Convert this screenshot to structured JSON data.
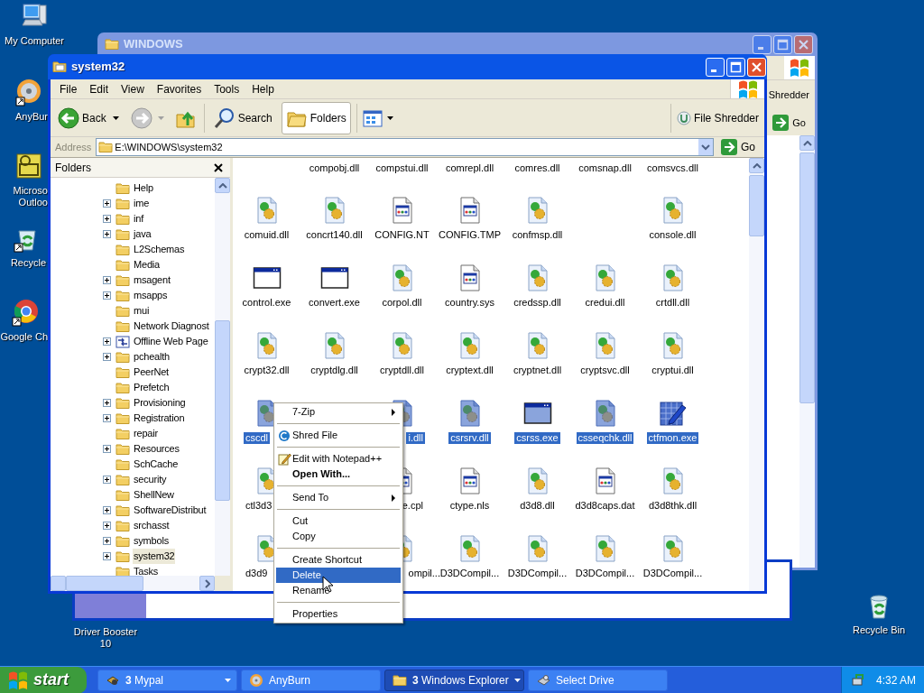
{
  "desktop_icons": [
    {
      "kind": "computer",
      "lines": [
        "My Computer"
      ]
    },
    {
      "kind": "disc",
      "lines": [
        "AnyBur"
      ]
    },
    {
      "kind": "mail",
      "lines": [
        "Microso",
        "Outloo"
      ]
    },
    {
      "kind": "recycle",
      "lines": [
        "Recycle"
      ]
    },
    {
      "kind": "browser",
      "lines": [
        "Google Ch"
      ]
    },
    {
      "lines": [
        "Driver Booster",
        "10"
      ]
    },
    {
      "kind": "bin",
      "lines": [
        "Recycle Bin"
      ]
    }
  ],
  "back_window": {
    "title": "WINDOWS",
    "toolbar_text": "Shredder",
    "go": "Go"
  },
  "window": {
    "title": "system32",
    "menu": [
      "File",
      "Edit",
      "View",
      "Favorites",
      "Tools",
      "Help"
    ],
    "toolbar": {
      "back": "Back",
      "search": "Search",
      "folders": {
        "label": "Folders",
        "selected": true
      },
      "shredder": "File Shredder"
    },
    "address": {
      "label": "Address",
      "value": "E:\\WINDOWS\\system32",
      "go": "Go"
    },
    "folders_pane": {
      "title": "Folders",
      "items": [
        {
          "label": "Help",
          "expandable": false,
          "selected": false
        },
        {
          "label": "ime",
          "expandable": true,
          "selected": false
        },
        {
          "label": "inf",
          "expandable": true,
          "selected": false
        },
        {
          "label": "java",
          "expandable": true,
          "selected": false
        },
        {
          "label": "L2Schemas",
          "expandable": false,
          "selected": false
        },
        {
          "label": "Media",
          "expandable": false,
          "selected": false
        },
        {
          "label": "msagent",
          "expandable": true,
          "selected": false
        },
        {
          "label": "msapps",
          "expandable": true,
          "selected": false
        },
        {
          "label": "mui",
          "expandable": false,
          "selected": false
        },
        {
          "label": "Network Diagnost",
          "expandable": false,
          "selected": false
        },
        {
          "label": "Offline Web Page",
          "expandable": true,
          "selected": false,
          "kind": "web"
        },
        {
          "label": "pchealth",
          "expandable": true,
          "selected": false
        },
        {
          "label": "PeerNet",
          "expandable": false,
          "selected": false
        },
        {
          "label": "Prefetch",
          "expandable": false,
          "selected": false
        },
        {
          "label": "Provisioning",
          "expandable": true,
          "selected": false
        },
        {
          "label": "Registration",
          "expandable": true,
          "selected": false
        },
        {
          "label": "repair",
          "expandable": false,
          "selected": false
        },
        {
          "label": "Resources",
          "expandable": true,
          "selected": false
        },
        {
          "label": "SchCache",
          "expandable": false,
          "selected": false
        },
        {
          "label": "security",
          "expandable": true,
          "selected": false
        },
        {
          "label": "ShellNew",
          "expandable": false,
          "selected": false
        },
        {
          "label": "SoftwareDistribut",
          "expandable": true,
          "selected": false
        },
        {
          "label": "srchasst",
          "expandable": true,
          "selected": false
        },
        {
          "label": "symbols",
          "expandable": true,
          "selected": false
        },
        {
          "label": "system32",
          "expandable": true,
          "selected": true
        },
        {
          "label": "Tasks",
          "expandable": false,
          "selected": false
        }
      ]
    },
    "file_grid": {
      "top_labels": [
        "compobj.dll",
        "compstui.dll",
        "comrepl.dll",
        "comres.dll",
        "comsnap.dll",
        "comsvcs.dll"
      ],
      "rows": [
        [
          {
            "name": "comuid.dll",
            "kind": "dll",
            "selected": false
          },
          {
            "name": "concrt140.dll",
            "kind": "dll",
            "selected": false
          },
          {
            "name": "CONFIG.NT",
            "kind": "doc",
            "selected": false
          },
          {
            "name": "CONFIG.TMP",
            "kind": "doc",
            "selected": false
          },
          {
            "name": "confmsp.dll",
            "kind": "dll",
            "selected": false
          },
          null,
          {
            "name": "console.dll",
            "kind": "dll",
            "selected": false
          }
        ],
        [
          {
            "name": "control.exe",
            "kind": "exe",
            "selected": false
          },
          {
            "name": "convert.exe",
            "kind": "exe",
            "selected": false
          },
          {
            "name": "corpol.dll",
            "kind": "dll",
            "selected": false
          },
          {
            "name": "country.sys",
            "kind": "doc",
            "selected": false
          },
          {
            "name": "credssp.dll",
            "kind": "dll",
            "selected": false
          },
          {
            "name": "credui.dll",
            "kind": "dll",
            "selected": false
          },
          {
            "name": "crtdll.dll",
            "kind": "dll",
            "selected": false
          }
        ],
        [
          {
            "name": "crypt32.dll",
            "kind": "dll",
            "selected": false
          },
          {
            "name": "cryptdlg.dll",
            "kind": "dll",
            "selected": false
          },
          {
            "name": "cryptdll.dll",
            "kind": "dll",
            "selected": false
          },
          {
            "name": "cryptext.dll",
            "kind": "dll",
            "selected": false
          },
          {
            "name": "cryptnet.dll",
            "kind": "dll",
            "selected": false
          },
          {
            "name": "cryptsvc.dll",
            "kind": "dll",
            "selected": false
          },
          {
            "name": "cryptui.dll",
            "kind": "dll",
            "selected": false
          }
        ],
        [
          {
            "name": "cscdl",
            "kind": "dll",
            "selected": true
          },
          null,
          {
            "name": "i.dll",
            "kind": "dll",
            "selected": true
          },
          {
            "name": "csrsrv.dll",
            "kind": "dll",
            "selected": true
          },
          {
            "name": "csrss.exe",
            "kind": "exe",
            "selected": true
          },
          {
            "name": "csseqchk.dll",
            "kind": "dll",
            "selected": true
          },
          {
            "name": "ctfmon.exe",
            "kind": "pen",
            "selected": true
          }
        ],
        [
          {
            "name": "ctl3d3",
            "kind": "dll",
            "selected": false
          },
          null,
          {
            "name": "e.cpl",
            "kind": "doc",
            "selected": false
          },
          {
            "name": "ctype.nls",
            "kind": "doc",
            "selected": false
          },
          {
            "name": "d3d8.dll",
            "kind": "dll",
            "selected": false
          },
          {
            "name": "d3d8caps.dat",
            "kind": "doc",
            "selected": false
          },
          {
            "name": "d3d8thk.dll",
            "kind": "dll",
            "selected": false
          }
        ],
        [
          {
            "name": "d3d9",
            "kind": "dll",
            "selected": false
          },
          null,
          {
            "name": "ompil...",
            "kind": "dll",
            "selected": false
          },
          {
            "name": "D3DCompil...",
            "kind": "dll",
            "selected": false
          },
          {
            "name": "D3DCompil...",
            "kind": "dll",
            "selected": false
          },
          {
            "name": "D3DCompil...",
            "kind": "dll",
            "selected": false
          },
          {
            "name": "D3DCompil...",
            "kind": "dll",
            "selected": false
          }
        ]
      ]
    }
  },
  "context_menu": [
    {
      "kind": "item",
      "label": "7-Zip",
      "submenu": true,
      "default": false,
      "selected": false
    },
    {
      "kind": "separator"
    },
    {
      "kind": "item",
      "label": "Shred File",
      "submenu": false,
      "default": false,
      "selected": false
    },
    {
      "kind": "separator"
    },
    {
      "kind": "item",
      "label": "Edit with Notepad++",
      "submenu": false,
      "default": false,
      "selected": false
    },
    {
      "kind": "item",
      "label": "Open With...",
      "submenu": false,
      "default": true,
      "selected": false
    },
    {
      "kind": "separator"
    },
    {
      "kind": "item",
      "label": "Send To",
      "submenu": true,
      "default": false,
      "selected": false
    },
    {
      "kind": "separator"
    },
    {
      "kind": "item",
      "label": "Cut",
      "submenu": false,
      "default": false,
      "selected": false
    },
    {
      "kind": "item",
      "label": "Copy",
      "submenu": false,
      "default": false,
      "selected": false
    },
    {
      "kind": "separator"
    },
    {
      "kind": "item",
      "label": "Create Shortcut",
      "submenu": false,
      "default": false,
      "selected": false
    },
    {
      "kind": "item",
      "label": "Delete",
      "submenu": false,
      "default": false,
      "selected": true
    },
    {
      "kind": "item",
      "label": "Rename",
      "submenu": false,
      "default": false,
      "selected": false
    },
    {
      "kind": "separator"
    },
    {
      "kind": "item",
      "label": "Properties",
      "submenu": false,
      "default": false,
      "selected": false
    }
  ],
  "taskbar": {
    "start": "start",
    "tasks": [
      {
        "label": "**3** Mypal",
        "grouped": true,
        "selected": false
      },
      {
        "label": "AnyBurn",
        "grouped": false,
        "selected": false
      },
      {
        "label": "**3** Windows Explorer",
        "grouped": true,
        "selected": true
      },
      {
        "label": "Select Drive",
        "grouped": false,
        "selected": false
      }
    ],
    "clock": "4:32 AM"
  }
}
